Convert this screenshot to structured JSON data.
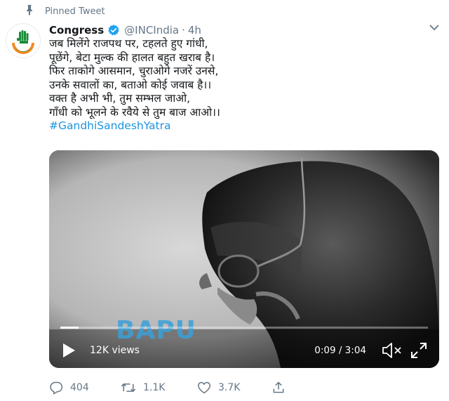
{
  "pinned": {
    "label": "Pinned Tweet"
  },
  "tweet": {
    "author_name": "Congress",
    "handle": "@INCIndia",
    "separator": "·",
    "time": "4h",
    "lines": [
      "जब मिलेंगे राजपथ पर, टहलते हुए गांधी,",
      "पूछेंगे, बेटा मुल्क की हालत बहुत खराब है।",
      "फिर ताकोगे आसमान, चुराओगे नजरें उनसे,",
      "उनके सवालों का, बताओ कोई जवाब है।।",
      "वक्त है अभी भी, तुम सम्भल जाओ,",
      "गाँधी को भूलने के रवैये से तुम बाज आओ।।"
    ],
    "hashtag": "#GandhiSandeshYatra"
  },
  "video": {
    "overlay_text": "BAPU",
    "views": "12K views",
    "timecode": "0:09 / 3:04",
    "progress_fraction": 0.05
  },
  "actions": {
    "replies": "404",
    "retweets": "1.1K",
    "likes": "3.7K"
  },
  "colors": {
    "accent": "#1b95e0",
    "secondary_text": "#657786",
    "verified": "#1da1f2",
    "logo_saffron": "#f48a1e",
    "logo_green": "#1a8d3a"
  },
  "icons": [
    "pin-icon",
    "verified-badge-icon",
    "chevron-down-icon",
    "play-icon",
    "volume-muted-icon",
    "fullscreen-icon",
    "reply-icon",
    "retweet-icon",
    "like-icon",
    "share-icon"
  ]
}
